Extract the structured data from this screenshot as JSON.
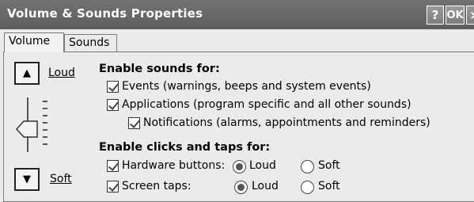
{
  "window": {
    "title": "Volume & Sounds Properties",
    "help_label": "?",
    "ok_label": "OK",
    "close_label": "×"
  },
  "tabs": [
    {
      "label": "Volume",
      "active": true
    },
    {
      "label": "Sounds",
      "active": false
    }
  ],
  "volume": {
    "loud_label": "Loud",
    "soft_label": "Soft",
    "up_icon": "▲",
    "down_icon": "▼"
  },
  "sounds_section": {
    "heading": "Enable sounds for:",
    "items": [
      {
        "label": "Events (warnings, beeps and system events)",
        "checked": true
      },
      {
        "label": "Applications (program specific and all other sounds)",
        "checked": true
      },
      {
        "label": "Notifications (alarms, appointments and reminders)",
        "checked": true
      }
    ]
  },
  "clicks_section": {
    "heading": "Enable clicks and taps for:",
    "hardware": {
      "label": "Hardware buttons:",
      "checked": true,
      "selected": "Loud"
    },
    "screen": {
      "label": "Screen taps:",
      "checked": true,
      "selected": "Loud"
    },
    "option_loud": "Loud",
    "option_soft": "Soft"
  }
}
